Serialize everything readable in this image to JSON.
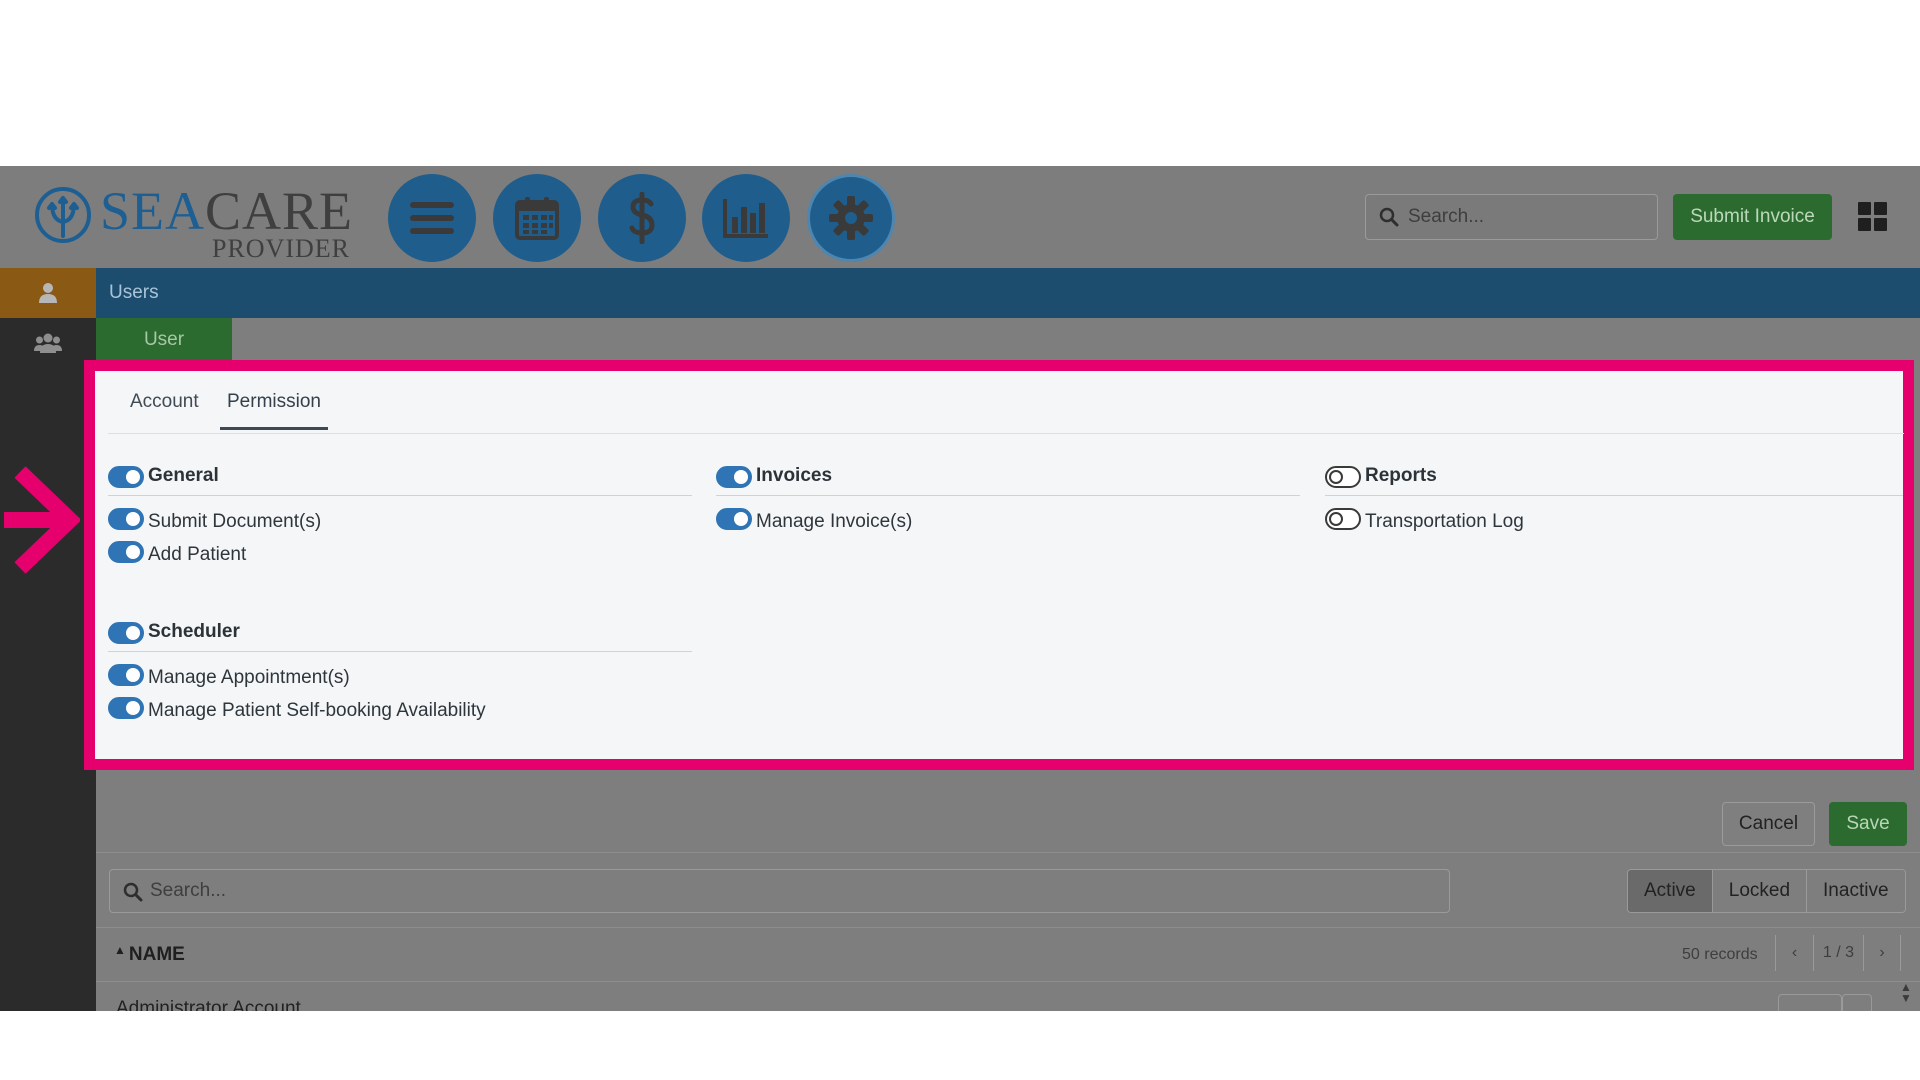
{
  "header": {
    "logo_main_sea": "SEA",
    "logo_main_care": "CARE",
    "logo_sub": "PROVIDER",
    "nav": [
      {
        "name": "menu-icon"
      },
      {
        "name": "calendar-icon"
      },
      {
        "name": "dollar-icon"
      },
      {
        "name": "bar-chart-icon"
      },
      {
        "name": "gear-icon"
      }
    ],
    "search_placeholder": "Search...",
    "submit_invoice_label": "Submit Invoice"
  },
  "breadcrumb": {
    "users_label": "Users",
    "user_tab_label": "User"
  },
  "panel": {
    "tabs": [
      {
        "label": "Account",
        "active": false
      },
      {
        "label": "Permission",
        "active": true
      }
    ],
    "columns": [
      {
        "groups": [
          {
            "title": "General",
            "enabled": true,
            "items": [
              {
                "label": "Submit Document(s)",
                "enabled": true
              },
              {
                "label": "Add Patient",
                "enabled": true
              }
            ]
          },
          {
            "title": "Scheduler",
            "enabled": true,
            "items": [
              {
                "label": "Manage Appointment(s)",
                "enabled": true
              },
              {
                "label": "Manage Patient Self-booking Availability",
                "enabled": true
              }
            ]
          }
        ]
      },
      {
        "groups": [
          {
            "title": "Invoices",
            "enabled": true,
            "items": [
              {
                "label": "Manage Invoice(s)",
                "enabled": true
              }
            ]
          }
        ]
      },
      {
        "groups": [
          {
            "title": "Reports",
            "enabled": false,
            "items": [
              {
                "label": "Transportation Log",
                "enabled": false
              }
            ]
          }
        ]
      }
    ]
  },
  "actions": {
    "cancel_label": "Cancel",
    "save_label": "Save"
  },
  "list": {
    "search_placeholder": "Search...",
    "filters": [
      {
        "label": "Active",
        "active": true
      },
      {
        "label": "Locked",
        "active": false
      },
      {
        "label": "Inactive",
        "active": false
      }
    ],
    "column_name": "NAME",
    "records": "50 records",
    "page": "1 / 3",
    "prev": "‹",
    "next": "›",
    "rows": [
      {
        "name": "Administrator Account"
      }
    ]
  },
  "colors": {
    "brand_blue": "#1f5e8c",
    "highlight_pink": "#e5006e",
    "toggle_on": "#2f74b5",
    "save_green": "#2c6b2f"
  }
}
